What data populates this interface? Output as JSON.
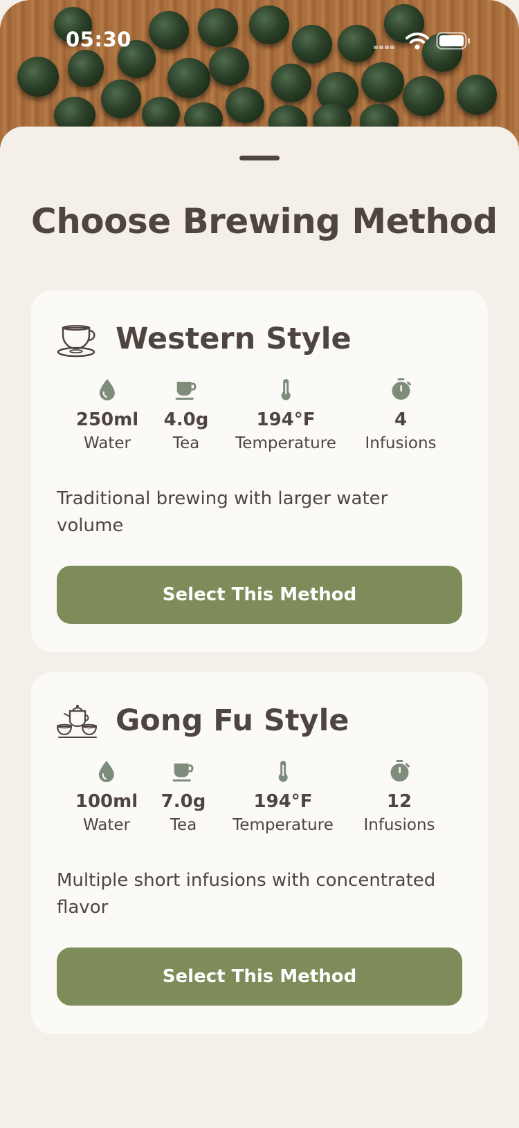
{
  "status_bar": {
    "time": "05:30"
  },
  "page": {
    "title": "Choose Brewing Method"
  },
  "methods": [
    {
      "name": "Western Style",
      "icon": "teacup-icon",
      "stats": [
        {
          "icon": "water-drop-icon",
          "value": "250ml",
          "label": "Water"
        },
        {
          "icon": "tea-cup-icon",
          "value": "4.0g",
          "label": "Tea"
        },
        {
          "icon": "thermometer-icon",
          "value": "194°F",
          "label": "Temperature"
        },
        {
          "icon": "stopwatch-icon",
          "value": "4",
          "label": "Infusions"
        }
      ],
      "description": "Traditional brewing with larger water volume",
      "button_label": "Select This Method"
    },
    {
      "name": "Gong Fu Style",
      "icon": "teapot-set-icon",
      "stats": [
        {
          "icon": "water-drop-icon",
          "value": "100ml",
          "label": "Water"
        },
        {
          "icon": "tea-cup-icon",
          "value": "7.0g",
          "label": "Tea"
        },
        {
          "icon": "thermometer-icon",
          "value": "194°F",
          "label": "Temperature"
        },
        {
          "icon": "stopwatch-icon",
          "value": "12",
          "label": "Infusions"
        }
      ],
      "description": "Multiple short infusions with concentrated flavor",
      "button_label": "Select This Method"
    }
  ],
  "colors": {
    "accent": "#7d8c59",
    "text": "#4f4540",
    "background": "#f4efe8",
    "card": "#fcfaf7"
  }
}
